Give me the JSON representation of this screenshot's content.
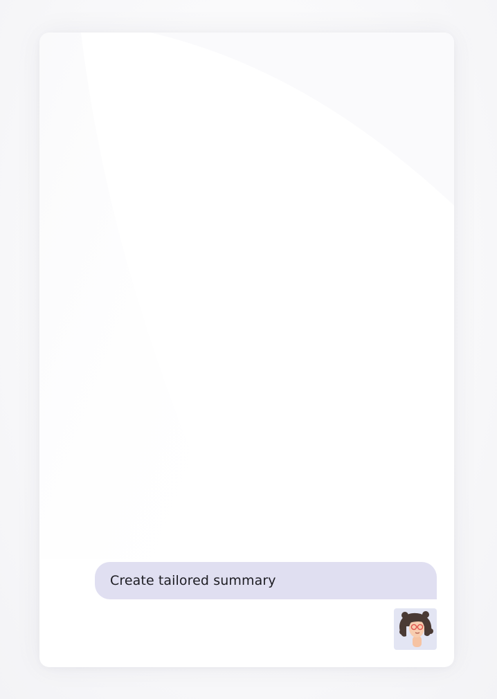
{
  "chat": {
    "messages": [
      {
        "role": "user",
        "text": "Create tailored summary"
      }
    ],
    "user_avatar": {
      "icon": "user-avatar-icon"
    }
  },
  "colors": {
    "page_background": "#f9f9fb",
    "card_background": "#ffffff",
    "bubble_background": "#e0dff1",
    "avatar_background": "#e3e5f3",
    "message_text": "#1c1c22"
  }
}
